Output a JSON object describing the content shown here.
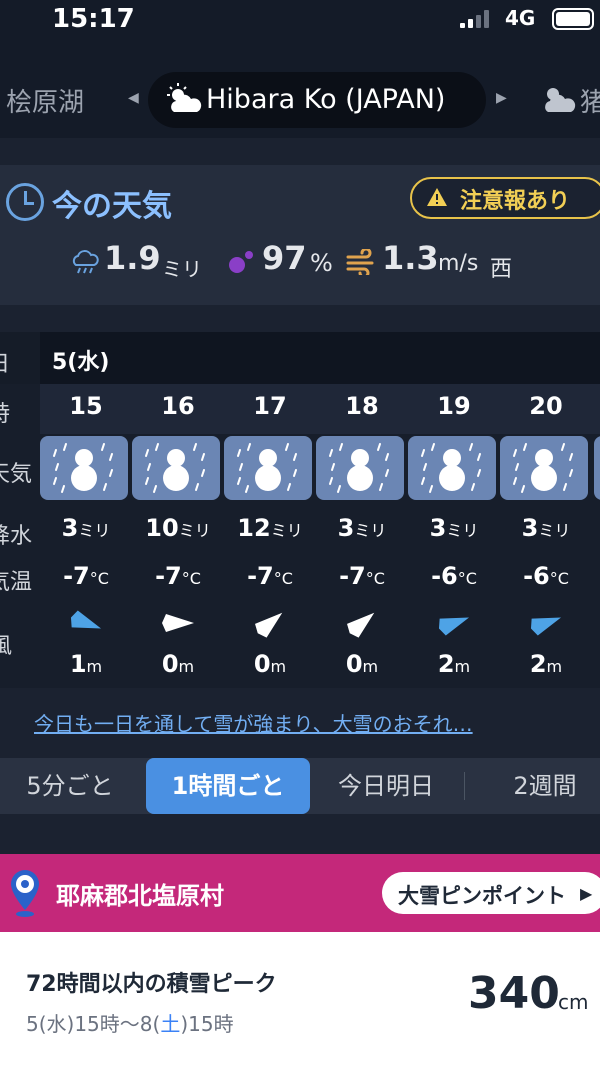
{
  "status_bar": {
    "time": "15:17",
    "network": "4G"
  },
  "location": {
    "prev": "桧原湖",
    "current": "Hibara Ko (JAPAN)",
    "next": "猪"
  },
  "current_weather": {
    "title": "今の天気",
    "alert": "注意報あり",
    "precip_value": "1.9",
    "precip_unit": "ミリ",
    "humidity_value": "97",
    "humidity_unit": "%",
    "wind_value": "1.3",
    "wind_unit": "m/s",
    "wind_dir": "西"
  },
  "hourly": {
    "labels": {
      "date": "日",
      "hour": "時",
      "weather": "天気",
      "precip": "降水",
      "temp": "気温",
      "wind": "風"
    },
    "date": "5(水)",
    "precip_unit": "ミリ",
    "temp_unit": "°C",
    "wind_unit": "m",
    "hours": [
      {
        "hour": "15",
        "weather": "snow-icon",
        "precip": "3",
        "temp": "-7",
        "wind_speed": "1",
        "wind_arrow_deg": 20
      },
      {
        "hour": "16",
        "weather": "snow-icon",
        "precip": "10",
        "temp": "-7",
        "wind_speed": "0",
        "wind_arrow_deg": 0
      },
      {
        "hour": "17",
        "weather": "snow-icon",
        "precip": "12",
        "temp": "-7",
        "wind_speed": "0",
        "wind_arrow_deg": -40
      },
      {
        "hour": "18",
        "weather": "snow-icon",
        "precip": "3",
        "temp": "-7",
        "wind_speed": "0",
        "wind_arrow_deg": -40
      },
      {
        "hour": "19",
        "weather": "snow-icon",
        "precip": "3",
        "temp": "-6",
        "wind_speed": "2",
        "wind_arrow_deg": -20
      },
      {
        "hour": "20",
        "weather": "snow-icon",
        "precip": "3",
        "temp": "-6",
        "wind_speed": "2",
        "wind_arrow_deg": -20
      }
    ]
  },
  "summary_link": "今日も一日を通して雪が強まり、大雪のおそれ…",
  "tabs": [
    {
      "label": "5分ごと",
      "active": false
    },
    {
      "label": "1時間ごと",
      "active": true
    },
    {
      "label": "今日明日",
      "active": false
    },
    {
      "label": "2週間",
      "active": false
    }
  ],
  "pinpoint": {
    "town": "耶麻郡北塩原村",
    "button": "大雪ピンポイント"
  },
  "snow_card": {
    "heading": "72時間以内の積雪ピーク",
    "range_start": "5(水)15時〜8(",
    "range_sat": "土",
    "range_end": ")15時",
    "value": "340",
    "unit": "cm"
  },
  "colors": {
    "accent": "#4a90e2",
    "alert": "#f2cf55",
    "banner": "#c4287a",
    "weather_box": "#6b86b4",
    "wind_arrow": "#4ea3e6"
  }
}
